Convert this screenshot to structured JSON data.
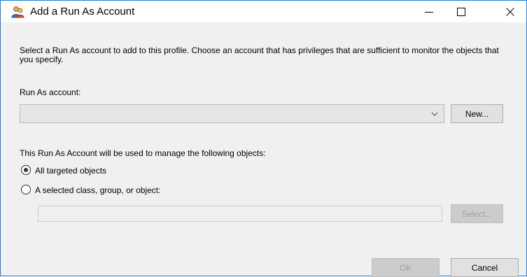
{
  "window": {
    "title": "Add a Run As Account"
  },
  "description": "Select a Run As account to add to this profile.  Choose an account that has privileges that are sufficient to monitor the objects that you specify.",
  "run_as": {
    "label": "Run As account:",
    "selected": "",
    "new_button": "New..."
  },
  "scope": {
    "label": "This Run As Account will be used to manage the following objects:",
    "options": [
      {
        "label": "All targeted objects",
        "checked": true
      },
      {
        "label": "A selected class, group, or object:",
        "checked": false
      }
    ],
    "object_value": "",
    "select_button": "Select..."
  },
  "footer": {
    "ok_label": "OK",
    "cancel_label": "Cancel"
  }
}
